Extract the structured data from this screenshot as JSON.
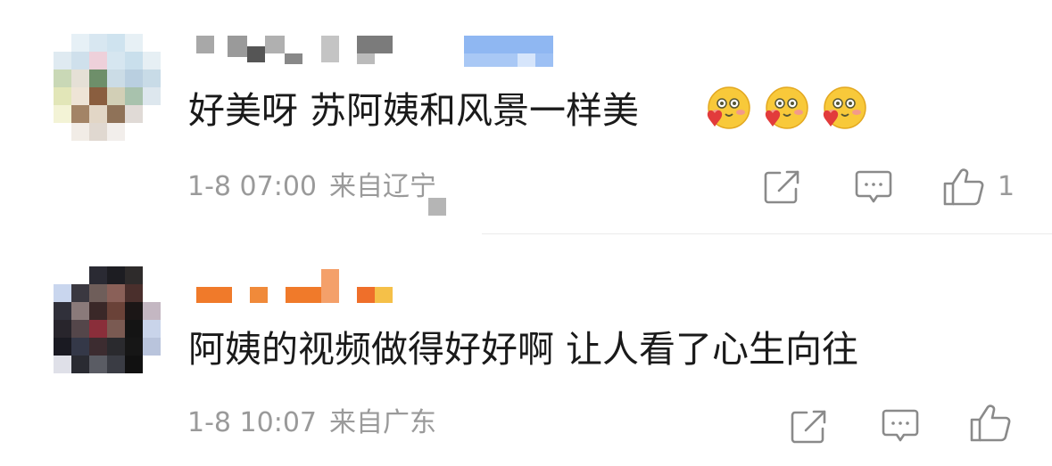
{
  "comments": [
    {
      "text": "好美呀  苏阿姨和风景一样美",
      "emoji_names": [
        "heart-face-emoji",
        "heart-face-emoji",
        "heart-face-emoji"
      ],
      "date": "1-8 07:00",
      "location": "来自辽宁",
      "like_count": "1"
    },
    {
      "text": "阿姨的视频做得好好啊 让人看了心生向往",
      "date": "1-8 10:07",
      "location": "来自广东",
      "like_count": ""
    }
  ],
  "icons": {
    "share": "share-icon",
    "comment": "comment-icon",
    "like": "like-icon"
  },
  "colors": {
    "text": "#1a1a1a",
    "meta": "#9a9a9a",
    "icon": "#8a8a8a",
    "badge_blue": "#8fb7f2",
    "name_orange": "#f07a2a"
  }
}
